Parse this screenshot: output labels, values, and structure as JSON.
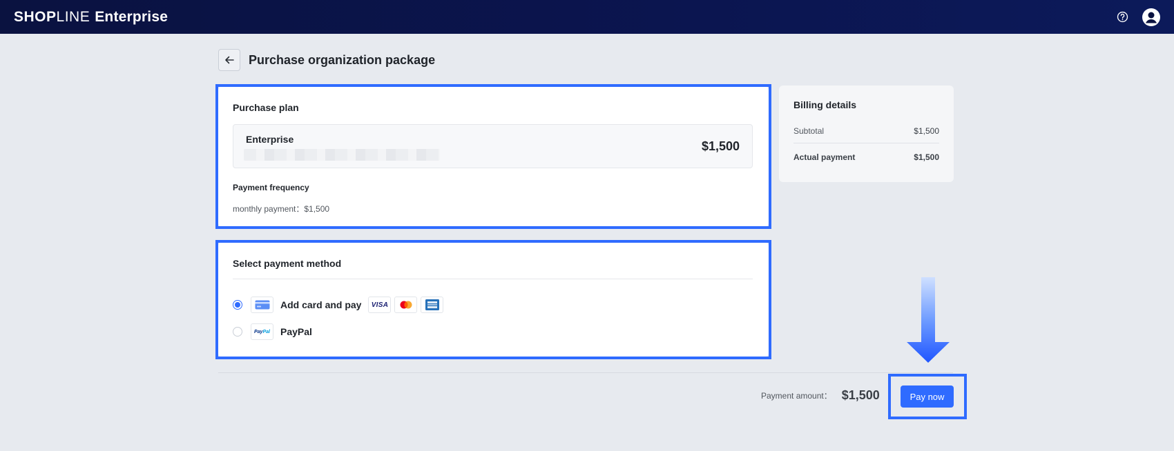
{
  "header": {
    "logo_main": "SHOP",
    "logo_thin": "LINE",
    "logo_suffix": "Enterprise",
    "help_icon": "help-circle-icon",
    "account_icon": "user-avatar-icon"
  },
  "page": {
    "title": "Purchase organization package",
    "back_icon": "arrow-left-icon"
  },
  "purchase_plan": {
    "title": "Purchase plan",
    "plan_name": "Enterprise",
    "plan_price": "$1,500",
    "frequency_label": "Payment frequency",
    "frequency_value": "monthly payment：$1,500"
  },
  "payment_method": {
    "title": "Select payment method",
    "options": [
      {
        "label": "Add card and pay",
        "selected": true,
        "icon": "credit-card-icon",
        "brands": [
          "VISA",
          "mastercard",
          "amex"
        ]
      },
      {
        "label": "PayPal",
        "selected": false,
        "icon": "paypal-icon"
      }
    ]
  },
  "billing": {
    "title": "Billing details",
    "subtotal_label": "Subtotal",
    "subtotal_value": "$1,500",
    "actual_label": "Actual payment",
    "actual_value": "$1,500"
  },
  "footer": {
    "amount_label": "Payment amount：",
    "amount_value": "$1,500",
    "pay_button": "Pay now"
  },
  "colors": {
    "accent": "#2f6bff",
    "header_bg": "#0a1240",
    "page_bg": "#e7eaef",
    "highlight": "#2f6bff"
  }
}
